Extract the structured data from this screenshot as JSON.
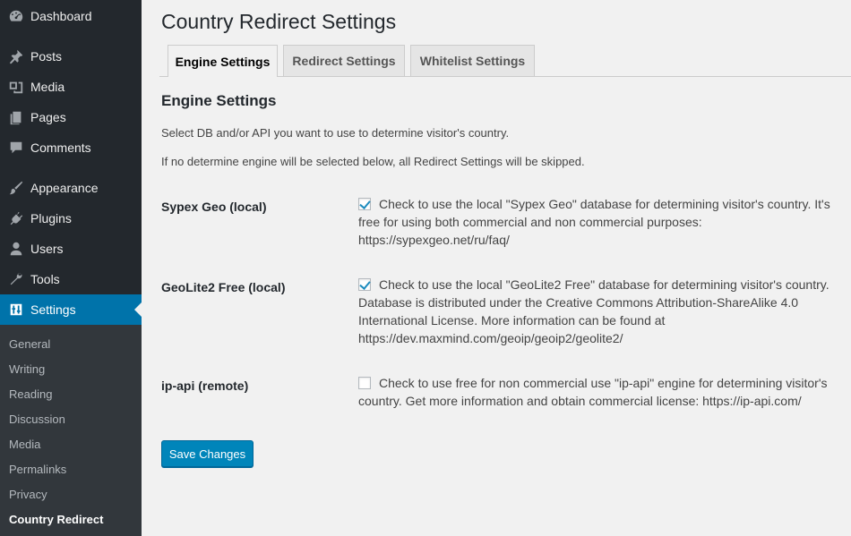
{
  "sidebar": {
    "menu": [
      {
        "label": "Dashboard",
        "icon": "dashboard-icon"
      },
      {
        "label": "Posts",
        "icon": "pin-icon"
      },
      {
        "label": "Media",
        "icon": "media-icon"
      },
      {
        "label": "Pages",
        "icon": "pages-icon"
      },
      {
        "label": "Comments",
        "icon": "comments-icon"
      },
      {
        "label": "Appearance",
        "icon": "brush-icon"
      },
      {
        "label": "Plugins",
        "icon": "plugin-icon"
      },
      {
        "label": "Users",
        "icon": "user-icon"
      },
      {
        "label": "Tools",
        "icon": "wrench-icon"
      },
      {
        "label": "Settings",
        "icon": "settings-icon"
      }
    ],
    "submenu": [
      "General",
      "Writing",
      "Reading",
      "Discussion",
      "Media",
      "Permalinks",
      "Privacy",
      "Country Redirect"
    ]
  },
  "page": {
    "title": "Country Redirect Settings",
    "tabs": [
      "Engine Settings",
      "Redirect Settings",
      "Whitelist Settings"
    ],
    "section_title": "Engine Settings",
    "desc1": "Select DB and/or API you want to use to determine visitor's country.",
    "desc2": "If no determine engine will be selected below, all Redirect Settings will be skipped.",
    "rows": [
      {
        "label": "Sypex Geo (local)",
        "checked": true,
        "text": "Check to use the local \"Sypex Geo\" database for determining visitor's country. It's free for using both commercial and non commercial purposes: https://sypexgeo.net/ru/faq/"
      },
      {
        "label": "GeoLite2 Free (local)",
        "checked": true,
        "text": "Check to use the local \"GeoLite2 Free\" database for determining visitor's country. Database is distributed under the Creative Commons Attribution-ShareAlike 4.0 International License. More information can be found at https://dev.maxmind.com/geoip/geoip2/geolite2/"
      },
      {
        "label": "ip-api (remote)",
        "checked": false,
        "text": "Check to use free for non commercial use \"ip-api\" engine for determining visitor's country. Get more information and obtain commercial license: https://ip-api.com/"
      }
    ],
    "save_label": "Save Changes"
  },
  "colors": {
    "sidebar_bg": "#23282d",
    "submenu_bg": "#32373c",
    "accent": "#0073aa",
    "button": "#0085ba",
    "page_bg": "#f1f1f1"
  }
}
